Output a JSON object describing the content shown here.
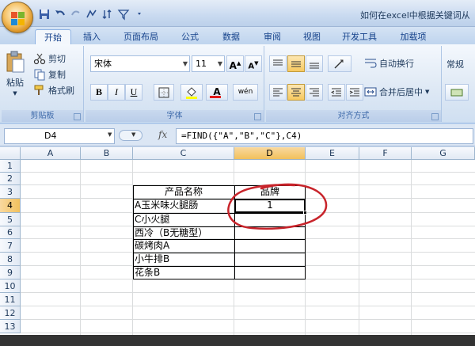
{
  "window": {
    "title": "如何在excel中根据关键词从"
  },
  "tabs": [
    {
      "label": "开始",
      "active": true
    },
    {
      "label": "插入"
    },
    {
      "label": "页面布局"
    },
    {
      "label": "公式"
    },
    {
      "label": "数据"
    },
    {
      "label": "审阅"
    },
    {
      "label": "视图"
    },
    {
      "label": "开发工具"
    },
    {
      "label": "加载项"
    }
  ],
  "clipboard": {
    "paste": "粘贴",
    "cut": "剪切",
    "copy": "复制",
    "format_painter": "格式刷",
    "group": "剪贴板"
  },
  "font": {
    "name": "宋体",
    "size": "11",
    "grow": "A",
    "shrink": "A",
    "bold": "B",
    "italic": "I",
    "underline": "U",
    "color_letter": "A",
    "phonetic": "wén",
    "group": "字体"
  },
  "alignment": {
    "wrap": "自动换行",
    "merge": "合并后居中",
    "group": "对齐方式"
  },
  "number": {
    "format": "常规"
  },
  "formula_bar": {
    "cell_ref": "D4",
    "fx": "fx",
    "formula": "=FIND({\"A\",\"B\",\"C\"},C4)"
  },
  "columns": [
    "A",
    "B",
    "C",
    "D",
    "E",
    "F",
    "G"
  ],
  "rows": [
    "1",
    "2",
    "3",
    "4",
    "5",
    "6",
    "7",
    "8",
    "9",
    "10",
    "11",
    "12",
    "13"
  ],
  "selected": {
    "col": "D",
    "row": "4"
  },
  "table": {
    "header_c": "产品名称",
    "header_d": "品牌",
    "rows": [
      {
        "name": "A玉米味火腿肠",
        "brand": "1"
      },
      {
        "name": "C小火腿",
        "brand": ""
      },
      {
        "name": "西冷（B无糖型）",
        "brand": ""
      },
      {
        "name": "碳烤肉A",
        "brand": ""
      },
      {
        "name": "小牛排B",
        "brand": ""
      },
      {
        "name": "花条B",
        "brand": ""
      }
    ]
  },
  "colors": {
    "ribbon": "#dfe9f5",
    "selection_header": "#f1c05c",
    "annotation": "#c8242b"
  }
}
